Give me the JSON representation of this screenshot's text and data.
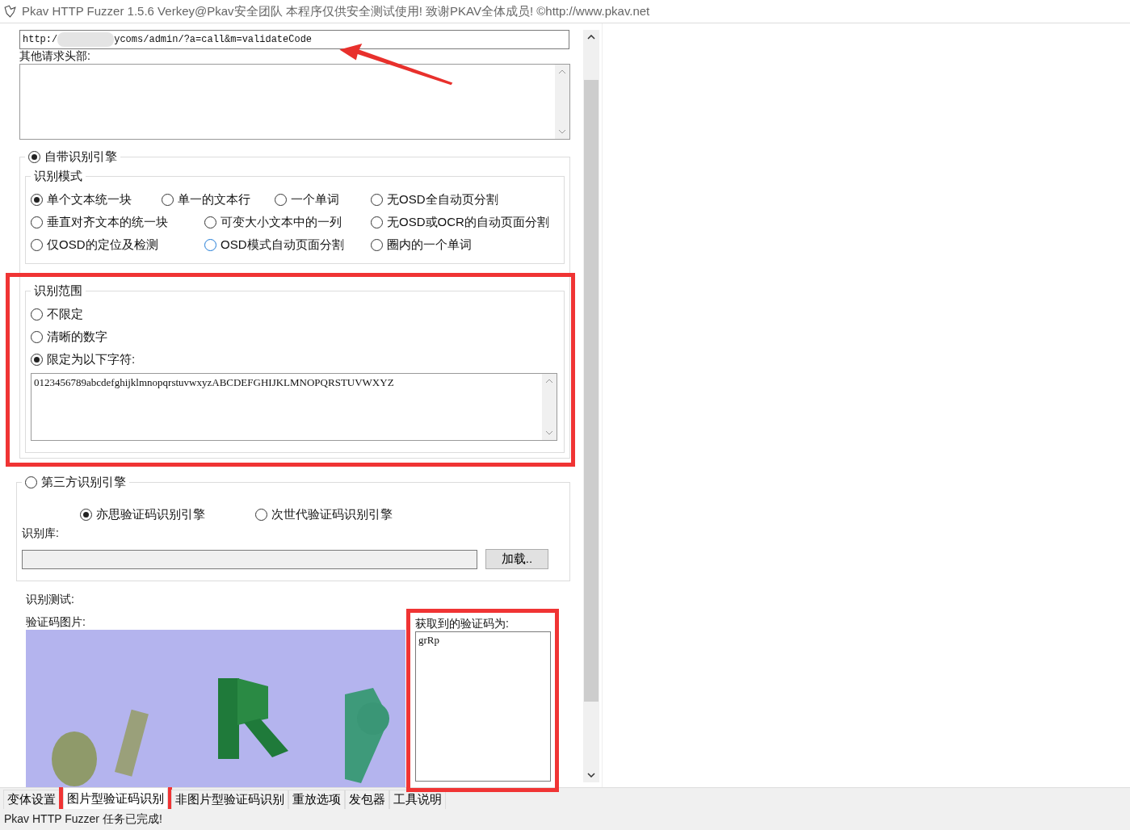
{
  "window": {
    "title": "Pkav HTTP Fuzzer 1.5.6  Verkey@Pkav安全团队  本程序仅供安全测试使用!  致谢PKAV全体成员! ©http://www.pkav.net"
  },
  "url_field": {
    "value_start": "http:/",
    "value_end": "ycoms/admin/?a=call&m=validateCode"
  },
  "headers": {
    "label": "其他请求头部:"
  },
  "builtin_engine": {
    "label": "自带识别引擎",
    "selected": true,
    "mode_group": {
      "label": "识别模式",
      "options": [
        {
          "label": "单个文本统一块",
          "selected": true
        },
        {
          "label": "单一的文本行",
          "selected": false
        },
        {
          "label": "一个单词",
          "selected": false
        },
        {
          "label": "无OSD全自动页分割",
          "selected": false
        },
        {
          "label": "垂直对齐文本的统一块",
          "selected": false
        },
        {
          "label": "可变大小文本中的一列",
          "selected": false
        },
        {
          "label": "无OSD或OCR的自动页面分割",
          "selected": false
        },
        {
          "label": "仅OSD的定位及检测",
          "selected": false
        },
        {
          "label": "OSD模式自动页面分割",
          "selected": false
        },
        {
          "label": "圈内的一个单词",
          "selected": false
        }
      ]
    },
    "range_group": {
      "label": "识别范围",
      "options": [
        {
          "label": "不限定",
          "selected": false
        },
        {
          "label": "清晰的数字",
          "selected": false
        },
        {
          "label": "限定为以下字符:",
          "selected": true
        }
      ],
      "charset": "0123456789abcdefghijklmnopqrstuvwxyzABCDEFGHIJKLMNOPQRSTUVWXYZ"
    }
  },
  "third_party_engine": {
    "label": "第三方识别引擎",
    "selected": false,
    "engines": [
      {
        "label": "亦思验证码识别引擎",
        "selected": true
      },
      {
        "label": "次世代验证码识别引擎",
        "selected": false
      }
    ],
    "library_label": "识别库:",
    "load_button": "加载.."
  },
  "test": {
    "label": "识别测试:",
    "image_label": "验证码图片:",
    "result_label": "获取到的验证码为:",
    "result": "grRp"
  },
  "tabs": [
    {
      "label": "变体设置",
      "selected": false
    },
    {
      "label": "图片型验证码识别",
      "selected": true
    },
    {
      "label": "非图片型验证码识别",
      "selected": false
    },
    {
      "label": "重放选项",
      "selected": false
    },
    {
      "label": "发包器",
      "selected": false
    },
    {
      "label": "工具说明",
      "selected": false
    }
  ],
  "status_bar": "Pkav HTTP Fuzzer 任务已完成!"
}
